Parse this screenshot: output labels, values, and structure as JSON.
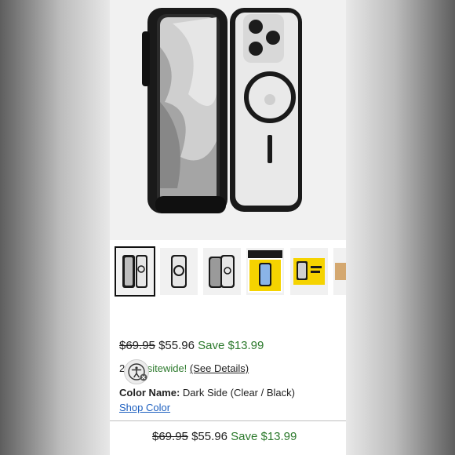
{
  "product": {
    "list_price": "$69.95",
    "sale_price": "$55.96",
    "savings": "Save $13.99"
  },
  "promo": {
    "prefix": "2",
    "text_green": "f sitewide!",
    "details_link": "(See Details)"
  },
  "color": {
    "label": "Color Name:",
    "value": "Dark Side (Clear / Black)",
    "shop_link": "Shop Color"
  },
  "sticky_bar": {
    "list_price": "$69.95",
    "sale_price": "$55.96",
    "savings": "Save $13.99"
  },
  "thumbnails": [
    {
      "name": "thumb-front-back",
      "selected": true
    },
    {
      "name": "thumb-back-ring",
      "selected": false
    },
    {
      "name": "thumb-clear-case",
      "selected": false
    },
    {
      "name": "thumb-screen-protection",
      "selected": false
    },
    {
      "name": "thumb-yellow-ad",
      "selected": false
    },
    {
      "name": "thumb-partial",
      "selected": false
    }
  ],
  "colors": {
    "accent_green": "#2d7a2d",
    "link_blue": "#1d5fbf",
    "case_black": "#1a1a1a"
  }
}
